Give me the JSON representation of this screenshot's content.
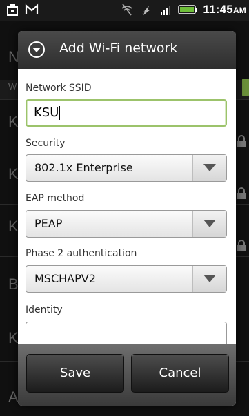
{
  "status_bar": {
    "time": "11:45",
    "ampm": "AM"
  },
  "dialog": {
    "title": "Add Wi-Fi network",
    "fields": {
      "ssid": {
        "label": "Network SSID",
        "value": "KSU"
      },
      "security": {
        "label": "Security",
        "value": "802.1x Enterprise"
      },
      "eap": {
        "label": "EAP method",
        "value": "PEAP"
      },
      "phase2": {
        "label": "Phase 2 authentication",
        "value": "MSCHAPV2"
      },
      "identity": {
        "label": "Identity",
        "value": ""
      }
    },
    "buttons": {
      "save": "Save",
      "cancel": "Cancel"
    }
  },
  "background": {
    "letters": [
      "N",
      "W",
      "K",
      "K",
      "K",
      "B",
      "K",
      "A"
    ]
  },
  "colors": {
    "focus_border": "#9cc36b",
    "header_bg": "#3a3a3a",
    "footer_bg": "#4a4a4a"
  }
}
